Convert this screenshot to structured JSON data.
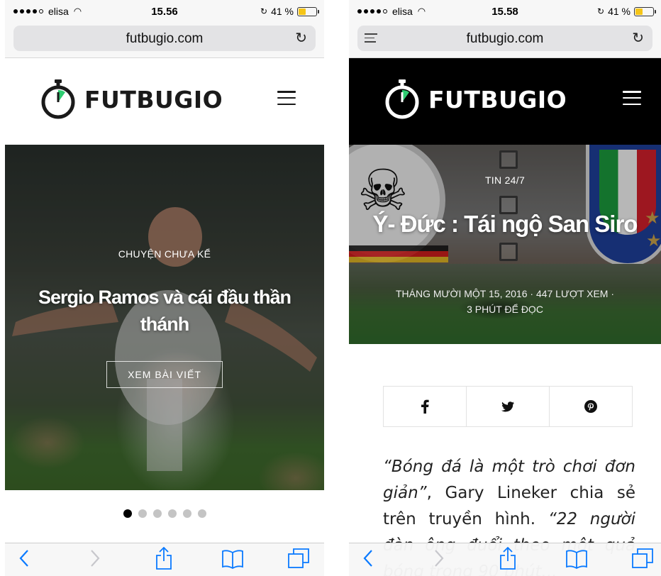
{
  "status_left": {
    "carrier": "elisa",
    "time": "15.56",
    "battery": "41 %",
    "battery_level": 0.41
  },
  "status_right": {
    "carrier": "elisa",
    "time": "15.58",
    "battery": "41 %",
    "battery_level": 0.41
  },
  "browser": {
    "url": "futbugio.com"
  },
  "site": {
    "logo_text": "FUTBUGIO"
  },
  "slide": {
    "kicker": "CHUYỆN CHƯA KỂ",
    "title": "Sergio Ramos và cái đầu thần thánh",
    "button": "XEM BÀI VIẾT",
    "total": 6,
    "active_index": 0
  },
  "article": {
    "category": "TIN 24/7",
    "title": "Ý- Đức : Tái ngộ San Siro",
    "meta_line1": "THÁNG MƯỜI MỘT 15, 2016  ·  447 LƯỢT XEM  ·",
    "meta_line2": "3 PHÚT ĐỂ ĐỌC",
    "quote1": "“Bóng đá là một trò chơi đơn giản”",
    "body1": ", Gary Lineker chia sẻ trên truyền hình. ",
    "quote2": "“22 người đàn ông đuổi theo một quả bóng trong 90 phút..."
  },
  "share": {
    "icons": [
      "facebook-icon",
      "twitter-icon",
      "pinterest-icon"
    ]
  },
  "colors": {
    "battery": "#f5c518",
    "logo_accent": "#2ecc71",
    "ios_blue": "#0a7aff"
  }
}
